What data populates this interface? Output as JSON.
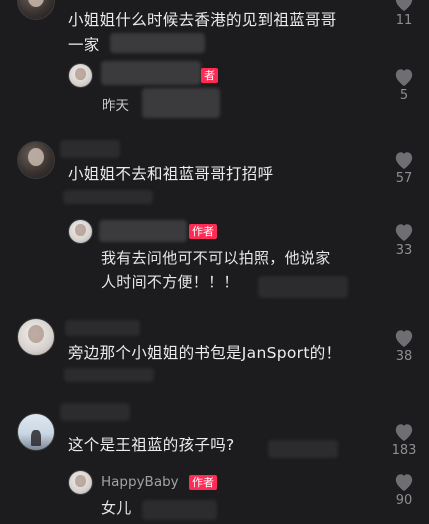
{
  "comments": [
    {
      "text_line1": "小姐姐什么时候去香港的见到祖蓝哥哥",
      "text_line2": "一家",
      "likes": "11",
      "reply": {
        "author_badge": "者",
        "timestamp": "昨天",
        "likes": "5"
      }
    },
    {
      "text": "小姐姐不去和祖蓝哥哥打招呼",
      "likes": "57",
      "reply": {
        "author_badge": "作者",
        "text_line1": "我有去问他可不可以拍照，他说家",
        "text_line2": "人时间不方便！！！",
        "likes": "33"
      }
    },
    {
      "text": "旁边那个小姐姐的书包是JanSport的！",
      "likes": "38"
    },
    {
      "text": "这个是王祖蓝的孩子吗?",
      "likes": "183",
      "reply": {
        "author_name": "HappyBaby",
        "author_badge": "作者",
        "text": "女儿",
        "likes": "90"
      }
    }
  ],
  "icons": {
    "like": "heart-icon"
  },
  "colors": {
    "background": "#1c1c1e",
    "badge": "#fe2c55",
    "muted": "#8e8e93"
  }
}
